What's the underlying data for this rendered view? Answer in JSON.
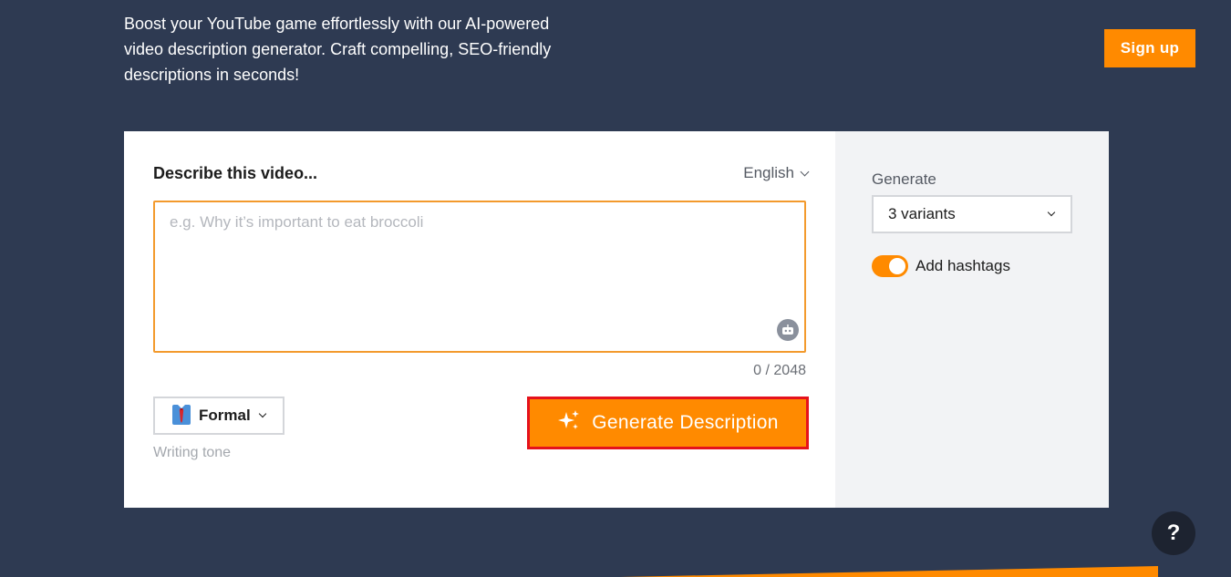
{
  "intro": {
    "text": "Boost your YouTube game effortlessly with our AI-powered video description generator. Craft compelling, SEO-friendly descriptions in seconds!"
  },
  "header": {
    "signup_label": "Sign up"
  },
  "form": {
    "describe_label": "Describe this video...",
    "language": "English",
    "input_value": "",
    "input_placeholder": "e.g. Why it’s important to eat broccoli",
    "counter": "0 / 2048",
    "tone_value": "Formal",
    "tone_caption": "Writing tone",
    "generate_label": "Generate Description"
  },
  "side": {
    "generate_label": "Generate",
    "variants_value": "3 variants",
    "hashtags_label": "Add hashtags",
    "hashtags_on": true
  },
  "help": {
    "label": "?"
  },
  "colors": {
    "background": "#2e3a52",
    "accent": "#ff8a00",
    "highlight_border": "#e5121c"
  },
  "icons": {
    "tone": "necktie-icon",
    "generate": "sparkles-icon",
    "assistant": "robot-icon"
  }
}
